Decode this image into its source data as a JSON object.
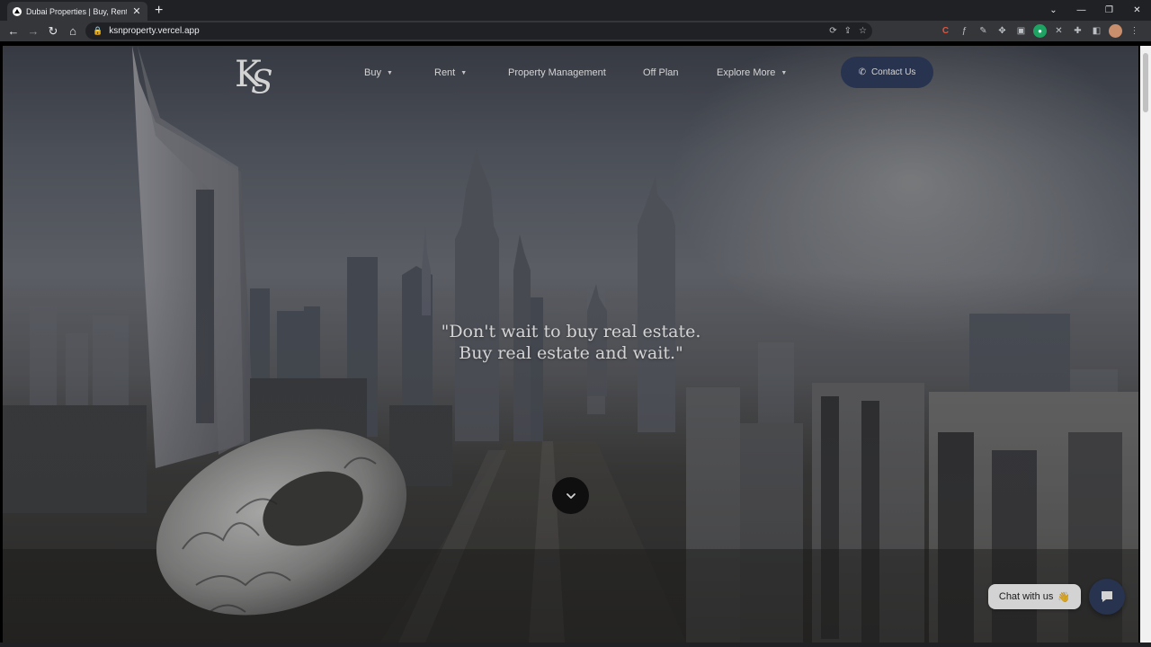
{
  "browser": {
    "tab_title": "Dubai Properties | Buy, Rent, and",
    "url": "ksnproperty.vercel.app"
  },
  "site": {
    "nav": [
      {
        "label": "Buy",
        "has_dropdown": true
      },
      {
        "label": "Rent",
        "has_dropdown": true
      },
      {
        "label": "Property Management",
        "has_dropdown": false
      },
      {
        "label": "Off Plan",
        "has_dropdown": false
      },
      {
        "label": "Explore More",
        "has_dropdown": true
      }
    ],
    "contact_label": "Contact Us",
    "quote_line1": "\"Don't wait to buy real estate.",
    "quote_line2": "Buy real estate and wait.\"",
    "chat_label": "Chat with us",
    "chat_emoji": "👋"
  },
  "colors": {
    "accent": "#2e3c5d",
    "chrome_dark": "#202124",
    "chrome_bar": "#35363a"
  }
}
